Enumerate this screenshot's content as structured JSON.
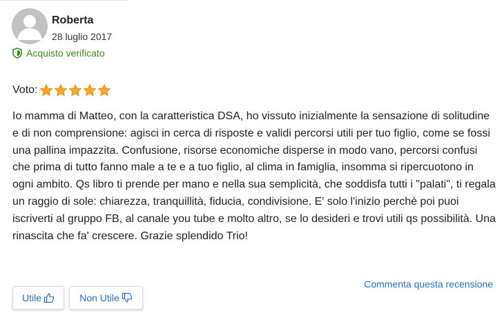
{
  "review": {
    "author": "Roberta",
    "date": "28 luglio 2017",
    "verified_label": "Acquisto verificato",
    "rating_label": "Voto:",
    "rating_value": 5,
    "rating_max": 5,
    "text": "Io mamma di Matteo, con la caratteristica DSA, ho vissuto inizialmente la sensazione di solitudine e di non comprensione: agisci in cerca di risposte e validi percorsi utili per tuo figlio, come se fossi una pallina impazzita. Confusione, risorse economiche disperse in modo vano, percorsi confusi che prima di tutto fanno male a te e a tuo figlio, al clima in famiglia, insomma si ripercuotono in ogni ambito. Qs libro ti prende per mano e nella sua semplicità, che soddisfa tutti i \"palati\", ti regala un raggio di sole: chiarezza, tranquillità, fiducia, condivisione. E' solo l'inizio perchè poi puoi iscriverti al gruppo FB, al canale you tube e molto altro, se lo desideri e trovi utili qs possibilità. Una rinascita che fa' crescere. Grazie splendido Trio!"
  },
  "actions": {
    "useful_label": "Utile",
    "not_useful_label": "Non Utile",
    "comment_label": "Commenta questa recensione"
  },
  "icons": {
    "avatar": "user-avatar-placeholder",
    "verified": "shield-check-icon",
    "star": "star-icon",
    "useful": "thumbs-up-icon",
    "not_useful": "thumbs-down-icon"
  },
  "colors": {
    "verified": "#3c8a1e",
    "link": "#2a6ebb",
    "star": "#f5a623",
    "avatar_bg": "#c2c2c2"
  }
}
